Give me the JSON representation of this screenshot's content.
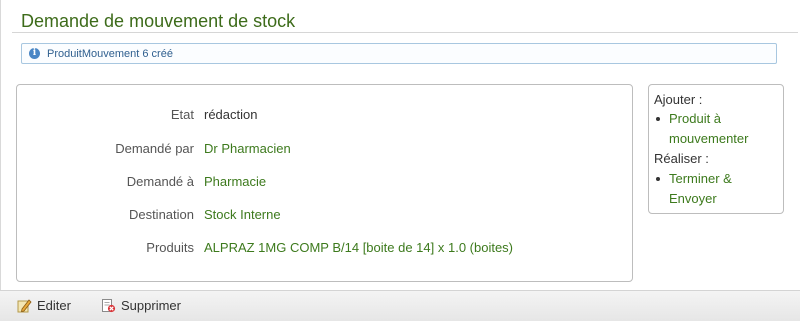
{
  "page_title": "Demande de mouvement de stock",
  "notice": {
    "text": "ProduitMouvement 6 créé",
    "icon": "info-icon"
  },
  "details": [
    {
      "label": "Etat",
      "value": "rédaction",
      "is_link": false
    },
    {
      "label": "Demandé par",
      "value": "Dr Pharmacien",
      "is_link": true
    },
    {
      "label": "Demandé à",
      "value": "Pharmacie",
      "is_link": true
    },
    {
      "label": "Destination",
      "value": "Stock Interne",
      "is_link": true
    },
    {
      "label": "Produits",
      "value": "ALPRAZ 1MG COMP B/14 [boite de 14] x 1.0 (boites)",
      "is_link": true
    }
  ],
  "side_panel": {
    "add_heading": "Ajouter :",
    "add_link_line1": "Produit à",
    "add_link_line2": "mouvementer",
    "do_heading": "Réaliser :",
    "do_link_line1": "Terminer &",
    "do_link_line2": "Envoyer"
  },
  "footer": {
    "edit_label": "Editer",
    "edit_icon": "pencil-icon",
    "delete_label": "Supprimer",
    "delete_icon": "delete-icon"
  },
  "colors": {
    "title": "#3d6b1a",
    "link": "#3d7a1d",
    "notice_border": "#a8c7e0",
    "notice_text": "#2f5f8f"
  }
}
